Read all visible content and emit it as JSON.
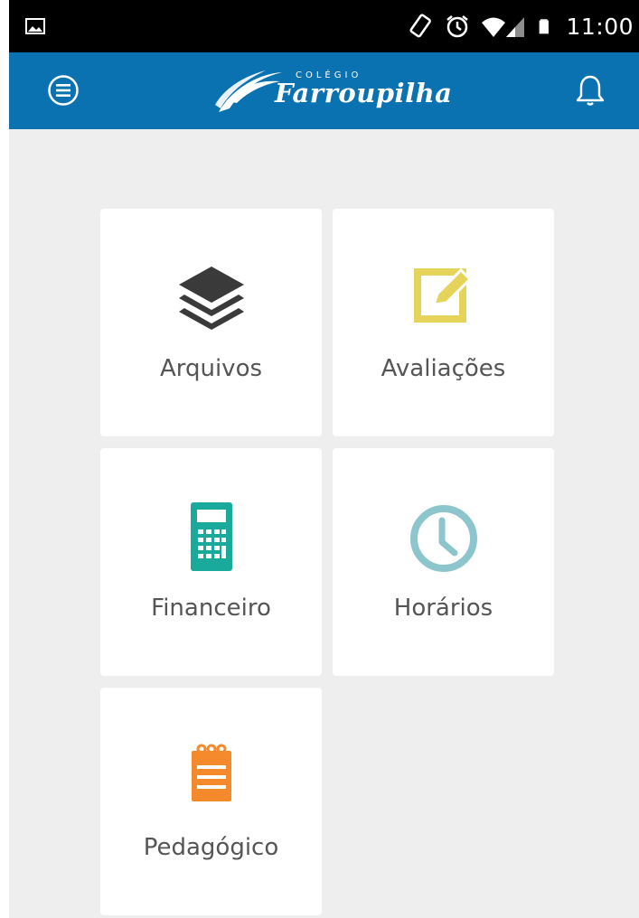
{
  "status_bar": {
    "time": "11:00",
    "icons": [
      "image-notification-icon",
      "rotate-icon",
      "alarm-icon",
      "wifi-icon",
      "signal-icon",
      "battery-icon"
    ]
  },
  "app_bar": {
    "logo_small_text": "COLÉGIO",
    "logo_name": "Farroupilha",
    "color": "#0a72b1"
  },
  "tiles": [
    {
      "label": "Arquivos",
      "icon": "layers-icon",
      "color": "#3a3a3a"
    },
    {
      "label": "Avaliações",
      "icon": "edit-icon",
      "color": "#e6d35a"
    },
    {
      "label": "Financeiro",
      "icon": "calculator-icon",
      "color": "#1aaa9b"
    },
    {
      "label": "Horários",
      "icon": "clock-icon",
      "color": "#8cc6cc"
    },
    {
      "label": "Pedagógico",
      "icon": "notepad-icon",
      "color": "#f58a2c"
    }
  ]
}
